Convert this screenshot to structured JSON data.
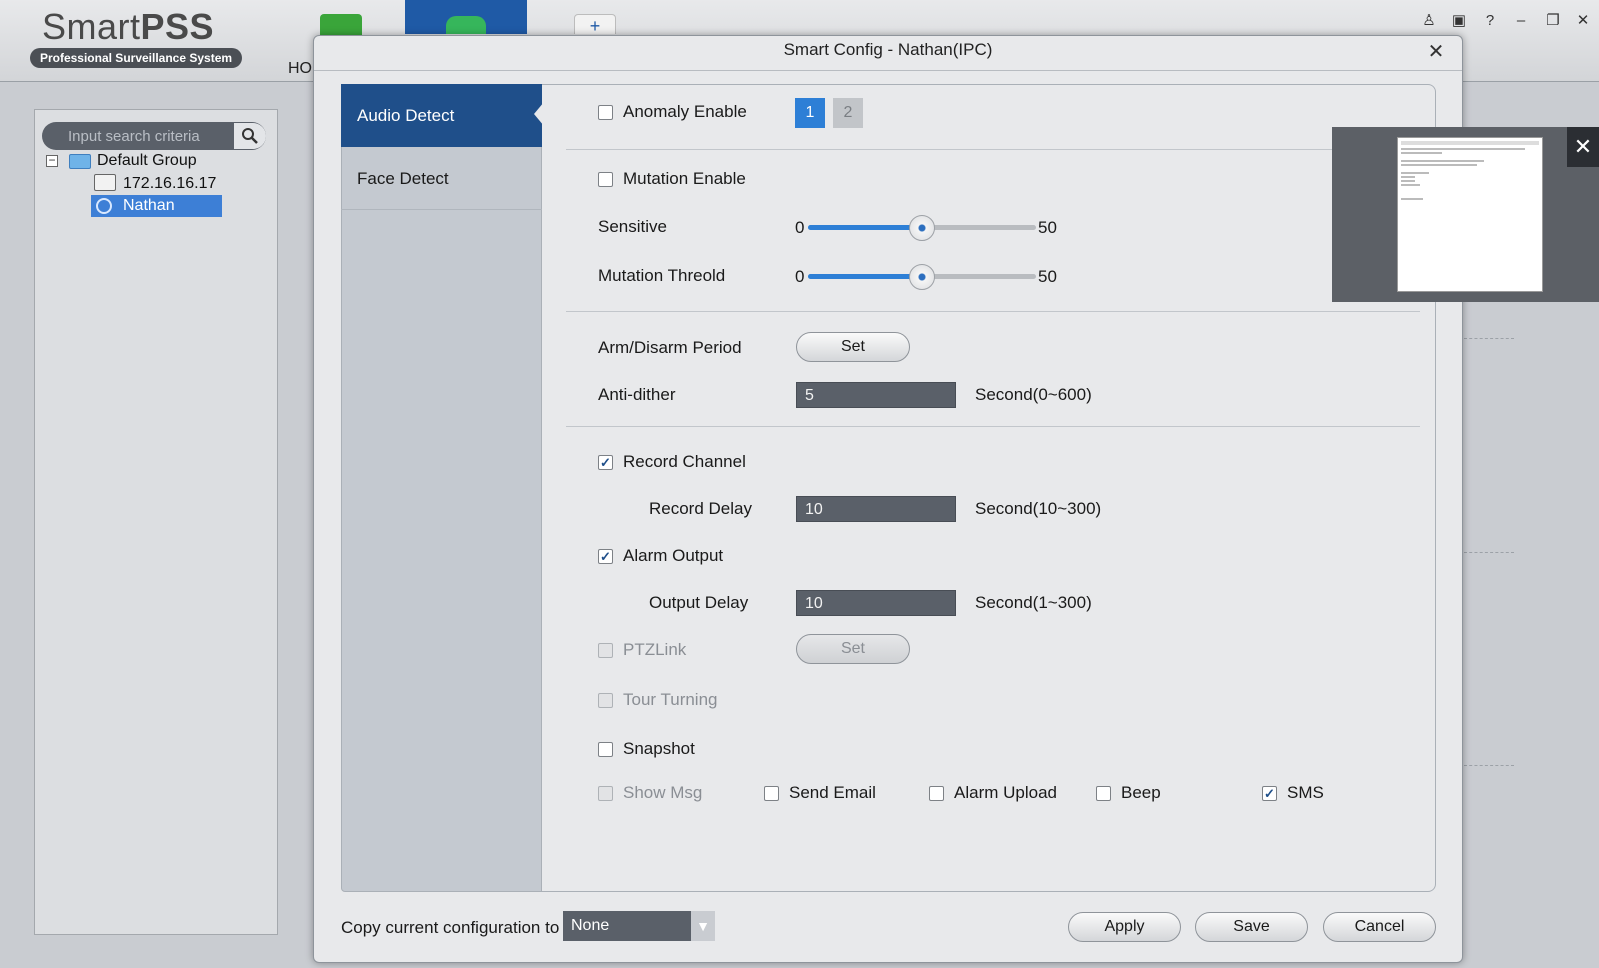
{
  "app": {
    "brand_light": "Smart",
    "brand_bold": "PSS",
    "subtitle": "Professional Surveillance System",
    "home_label": "HO",
    "add_tab_symbol": "+",
    "window_controls": [
      "user-icon",
      "lock-icon",
      "help-icon",
      "minimize-icon",
      "restore-icon",
      "close-icon"
    ],
    "window_control_glyphs": {
      "user": "♙",
      "lock": "▣",
      "help": "?",
      "minimize": "–",
      "restore": "❐",
      "close": "✕"
    }
  },
  "sidebar": {
    "search_placeholder": "Input search criteria",
    "search_icon": "search-icon",
    "tree": {
      "group_label": "Default Group",
      "collapse_symbol": "−",
      "device_label": "172.16.16.17",
      "camera_label": "Nathan"
    }
  },
  "dialog": {
    "title": "Smart Config - Nathan(IPC)",
    "close_symbol": "✕",
    "nav": {
      "audio_detect": "Audio Detect",
      "face_detect": "Face Detect"
    },
    "anomaly": {
      "label": "Anomaly Enable",
      "checked": false,
      "pages": [
        "1",
        "2"
      ],
      "active_page": "1"
    },
    "mutation": {
      "label": "Mutation Enable",
      "checked": false
    },
    "sensitive": {
      "label": "Sensitive",
      "min": "0",
      "max": "50",
      "value": 25
    },
    "mutation_threshold": {
      "label": "Mutation Threold",
      "min": "0",
      "max": "50",
      "value": 25
    },
    "arm_disarm": {
      "label": "Arm/Disarm Period",
      "button": "Set"
    },
    "anti_dither": {
      "label": "Anti-dither",
      "value": "5",
      "unit": "Second(0~600)"
    },
    "record_channel": {
      "label": "Record Channel",
      "checked": true,
      "check_symbol": "✓"
    },
    "record_delay": {
      "label": "Record Delay",
      "value": "10",
      "unit": "Second(10~300)"
    },
    "alarm_output": {
      "label": "Alarm Output",
      "checked": true,
      "check_symbol": "✓"
    },
    "output_delay": {
      "label": "Output Delay",
      "value": "10",
      "unit": "Second(1~300)"
    },
    "ptz_link": {
      "label": "PTZLink",
      "button": "Set",
      "enabled": false
    },
    "tour_turning": {
      "label": "Tour Turning",
      "enabled": false
    },
    "snapshot": {
      "label": "Snapshot",
      "checked": false
    },
    "show_msg": {
      "label": "Show Msg",
      "enabled": false
    },
    "send_email": {
      "label": "Send Email",
      "checked": false
    },
    "alarm_upload": {
      "label": "Alarm Upload",
      "checked": false
    },
    "beep": {
      "label": "Beep",
      "checked": false
    },
    "sms": {
      "label": "SMS",
      "checked": true,
      "check_symbol": "✓"
    },
    "copy": {
      "label": "Copy current configuration to",
      "value": "None",
      "arrow": "▼"
    },
    "buttons": {
      "apply": "Apply",
      "save": "Save",
      "cancel": "Cancel"
    }
  },
  "preview": {
    "close_symbol": "✕"
  },
  "colors": {
    "accent": "#2d7fd6",
    "nav_active": "#1f4f8a",
    "field_bg": "#5a6069"
  }
}
